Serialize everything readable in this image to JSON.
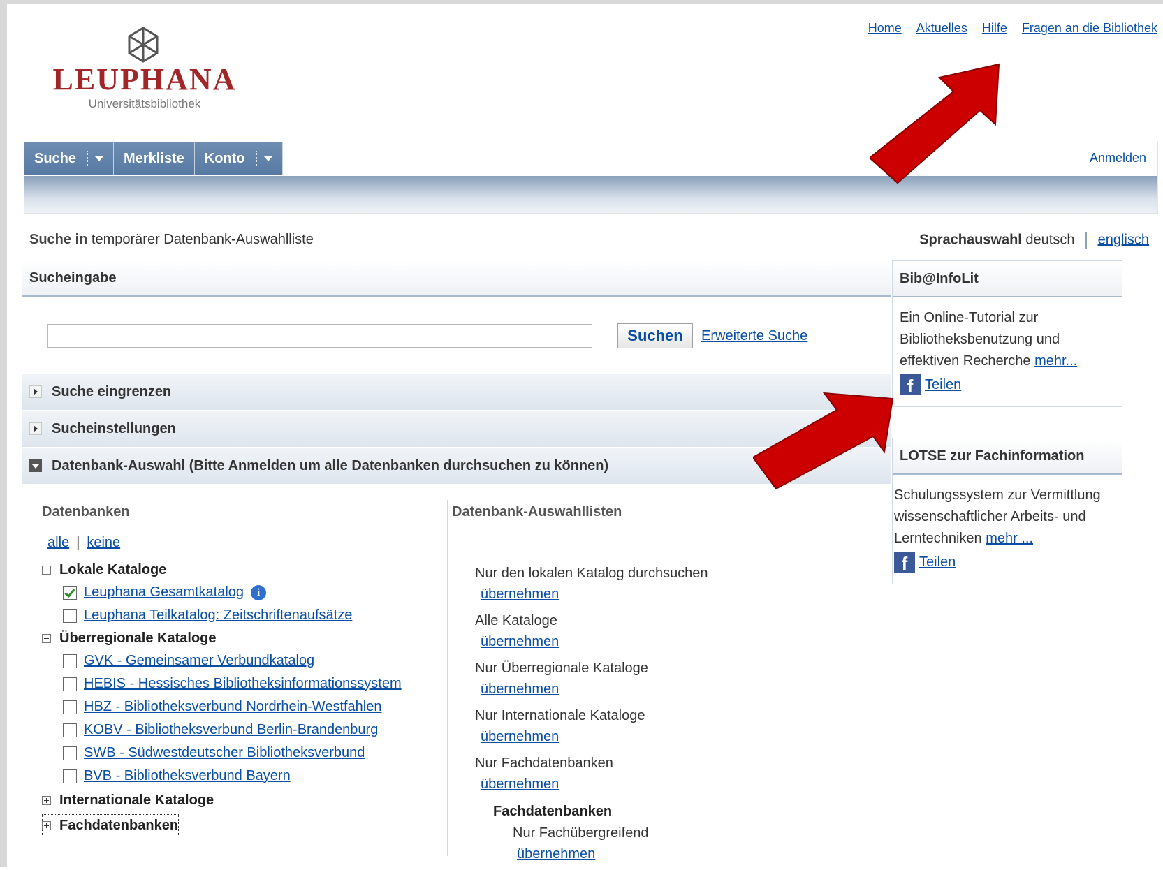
{
  "logo": {
    "name": "LEUPHANA",
    "subtitle": "Universitätsbibliothek"
  },
  "toplinks": [
    "Home",
    "Aktuelles",
    "Hilfe",
    "Fragen an die Bibliothek"
  ],
  "nav": {
    "tabs": [
      "Suche",
      "Merkliste",
      "Konto"
    ],
    "login": "Anmelden"
  },
  "searchin": {
    "label": "Suche in",
    "value": "temporärer Datenbank-Auswahlliste"
  },
  "language": {
    "label": "Sprachauswahl",
    "current": "deutsch",
    "other": "englisch"
  },
  "search": {
    "panel_title": "Sucheingabe",
    "input_value": "",
    "button": "Suchen",
    "advanced": "Erweiterte Suche"
  },
  "sections": {
    "narrow": "Suche eingrenzen",
    "settings": "Sucheinstellungen",
    "db_select": "Datenbank-Auswahl (Bitte Anmelden um alle Datenbanken durchsuchen zu können)"
  },
  "databases": {
    "heading": "Datenbanken",
    "all": "alle",
    "none": "keine",
    "groups": [
      {
        "label": "Lokale Kataloge",
        "expanded": true,
        "items": [
          {
            "label": "Leuphana Gesamtkatalog",
            "checked": true
          },
          {
            "label": "Leuphana Teilkatalog: Zeitschriftenaufsätze",
            "checked": false
          }
        ]
      },
      {
        "label": "Überregionale Kataloge",
        "expanded": true,
        "items": [
          {
            "label": "GVK - Gemeinsamer Verbundkatalog",
            "checked": false
          },
          {
            "label": "HEBIS - Hessisches Bibliotheksinformationssystem",
            "checked": false
          },
          {
            "label": "HBZ - Bibliotheksverbund Nordrhein-Westfahlen",
            "checked": false
          },
          {
            "label": "KOBV - Bibliotheksverbund Berlin-Brandenburg",
            "checked": false
          },
          {
            "label": "SWB - Südwestdeutscher Bibliotheksverbund",
            "checked": false
          },
          {
            "label": "BVB - Bibliotheksverbund Bayern",
            "checked": false
          }
        ]
      },
      {
        "label": "Internationale Kataloge",
        "expanded": false
      },
      {
        "label": "Fachdatenbanken",
        "expanded": false
      }
    ]
  },
  "selection_lists": {
    "heading": "Datenbank-Auswahllisten",
    "apply": "übernehmen",
    "entries": [
      "Nur den lokalen Katalog durchsuchen",
      "Alle Kataloge",
      "Nur Überregionale Kataloge",
      "Nur Internationale Kataloge",
      "Nur Fachdatenbanken"
    ],
    "subgroup": "Fachdatenbanken",
    "sub_entry": "Nur Fachübergreifend"
  },
  "sidebar": {
    "infolit": {
      "title": "Bib@InfoLit",
      "text": "Ein Online-Tutorial zur Bibliotheksbenutzung und effektiven Recherche",
      "more": "mehr...",
      "share": "Teilen"
    },
    "lotse": {
      "title": "LOTSE zur Fachinformation",
      "text": "Schulungssystem zur Vermittlung wissenschaftlicher Arbeits- und Lerntechniken",
      "more": "mehr ...",
      "share": "Teilen"
    }
  },
  "colors": {
    "brand": "#a02628",
    "link": "#0a4ea3",
    "nav": "#577aa3",
    "arrow": "#cc0000"
  },
  "icons": [
    "logo-cube-icon",
    "caret-down-icon",
    "expand-right-icon",
    "collapse-down-icon",
    "tree-minus-icon",
    "tree-plus-icon",
    "checkbox-icon",
    "info-icon",
    "facebook-icon",
    "red-arrow-icon"
  ]
}
